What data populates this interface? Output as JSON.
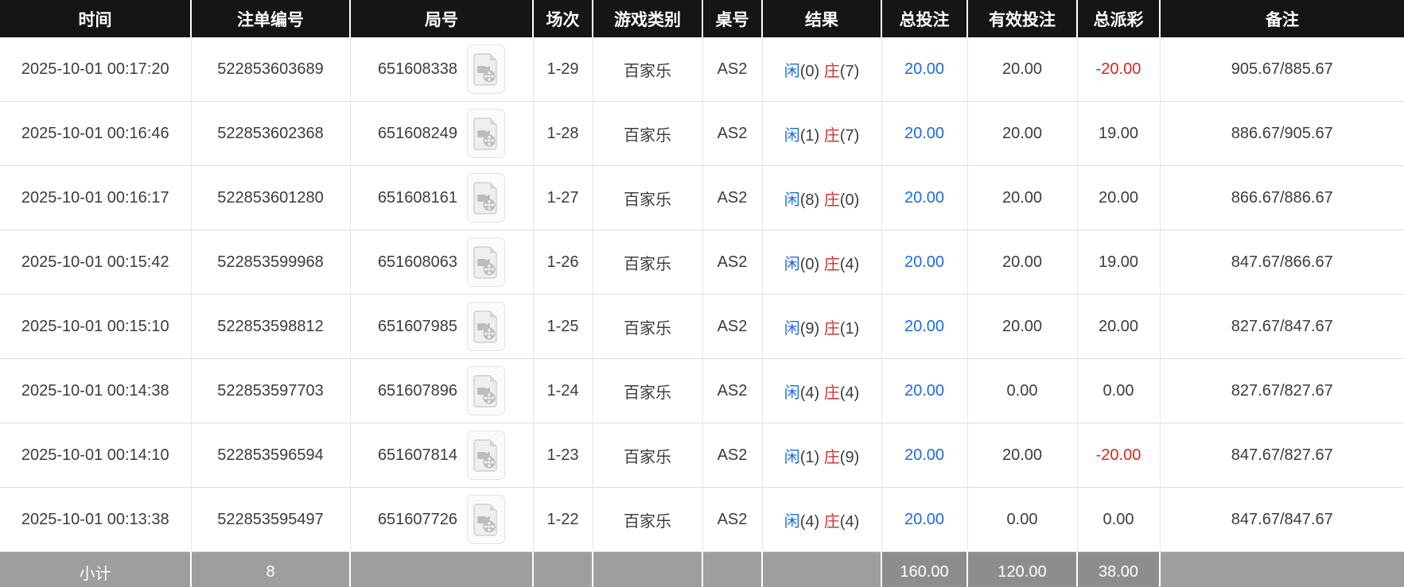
{
  "colors": {
    "header_bg": "#151515",
    "footer_bg": "#9e9e9e",
    "footer_value_bg": "#8d8d8d",
    "player_blue": "#1e6be6",
    "banker_red": "#d43030",
    "amount_blue": "#1e6be6",
    "negative_red": "#e82020"
  },
  "icons": {
    "round_video": "video-replay-icon"
  },
  "table": {
    "headers": [
      "时间",
      "注单编号",
      "局号",
      "场次",
      "游戏类别",
      "桌号",
      "结果",
      "总投注",
      "有效投注",
      "总派彩",
      "备注"
    ],
    "rows": [
      {
        "time": "2025-10-01 00:17:20",
        "bet_no": "522853603689",
        "round_no": "651608338",
        "session": "1-29",
        "game": "百家乐",
        "table_no": "AS2",
        "result_player": "闲",
        "result_player_score": "(0)",
        "result_banker": "庄",
        "result_banker_score": "(7)",
        "total_bet": "20.00",
        "valid_bet": "20.00",
        "payout": "-20.00",
        "remark": "905.67/885.67"
      },
      {
        "time": "2025-10-01 00:16:46",
        "bet_no": "522853602368",
        "round_no": "651608249",
        "session": "1-28",
        "game": "百家乐",
        "table_no": "AS2",
        "result_player": "闲",
        "result_player_score": "(1)",
        "result_banker": "庄",
        "result_banker_score": "(7)",
        "total_bet": "20.00",
        "valid_bet": "20.00",
        "payout": "19.00",
        "remark": "886.67/905.67"
      },
      {
        "time": "2025-10-01 00:16:17",
        "bet_no": "522853601280",
        "round_no": "651608161",
        "session": "1-27",
        "game": "百家乐",
        "table_no": "AS2",
        "result_player": "闲",
        "result_player_score": "(8)",
        "result_banker": "庄",
        "result_banker_score": "(0)",
        "total_bet": "20.00",
        "valid_bet": "20.00",
        "payout": "20.00",
        "remark": "866.67/886.67"
      },
      {
        "time": "2025-10-01 00:15:42",
        "bet_no": "522853599968",
        "round_no": "651608063",
        "session": "1-26",
        "game": "百家乐",
        "table_no": "AS2",
        "result_player": "闲",
        "result_player_score": "(0)",
        "result_banker": "庄",
        "result_banker_score": "(4)",
        "total_bet": "20.00",
        "valid_bet": "20.00",
        "payout": "19.00",
        "remark": "847.67/866.67"
      },
      {
        "time": "2025-10-01 00:15:10",
        "bet_no": "522853598812",
        "round_no": "651607985",
        "session": "1-25",
        "game": "百家乐",
        "table_no": "AS2",
        "result_player": "闲",
        "result_player_score": "(9)",
        "result_banker": "庄",
        "result_banker_score": "(1)",
        "total_bet": "20.00",
        "valid_bet": "20.00",
        "payout": "20.00",
        "remark": "827.67/847.67"
      },
      {
        "time": "2025-10-01 00:14:38",
        "bet_no": "522853597703",
        "round_no": "651607896",
        "session": "1-24",
        "game": "百家乐",
        "table_no": "AS2",
        "result_player": "闲",
        "result_player_score": "(4)",
        "result_banker": "庄",
        "result_banker_score": "(4)",
        "total_bet": "20.00",
        "valid_bet": "0.00",
        "payout": "0.00",
        "remark": "827.67/827.67"
      },
      {
        "time": "2025-10-01 00:14:10",
        "bet_no": "522853596594",
        "round_no": "651607814",
        "session": "1-23",
        "game": "百家乐",
        "table_no": "AS2",
        "result_player": "闲",
        "result_player_score": "(1)",
        "result_banker": "庄",
        "result_banker_score": "(9)",
        "total_bet": "20.00",
        "valid_bet": "20.00",
        "payout": "-20.00",
        "remark": "847.67/827.67"
      },
      {
        "time": "2025-10-01 00:13:38",
        "bet_no": "522853595497",
        "round_no": "651607726",
        "session": "1-22",
        "game": "百家乐",
        "table_no": "AS2",
        "result_player": "闲",
        "result_player_score": "(4)",
        "result_banker": "庄",
        "result_banker_score": "(4)",
        "total_bet": "20.00",
        "valid_bet": "0.00",
        "payout": "0.00",
        "remark": "847.67/847.67"
      }
    ],
    "footer": {
      "label": "小计",
      "count": "8",
      "total_bet": "160.00",
      "valid_bet": "120.00",
      "payout": "38.00"
    }
  }
}
